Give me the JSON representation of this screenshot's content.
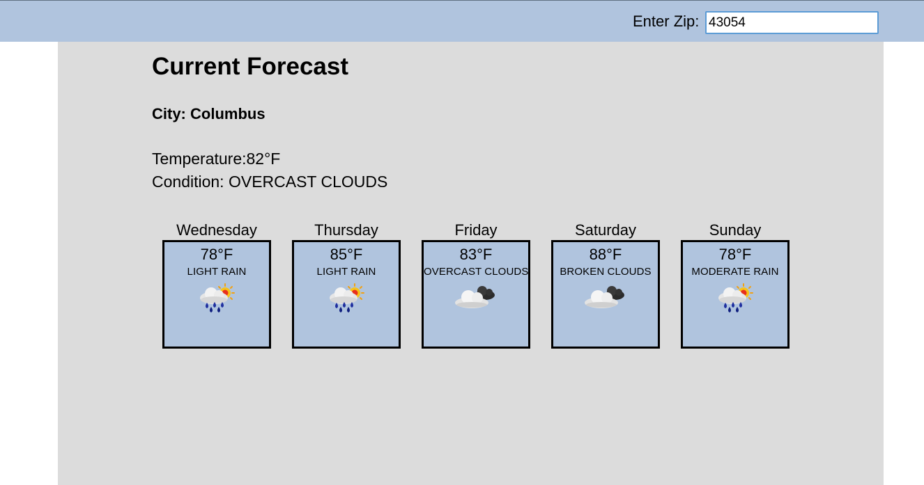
{
  "header": {
    "zip_label": "Enter Zip:",
    "zip_value": "43054"
  },
  "current": {
    "title": "Current Forecast",
    "city": "City: Columbus",
    "temperature": "Temperature:82°F",
    "condition": "Condition: OVERCAST CLOUDS"
  },
  "forecast": [
    {
      "day": "Wednesday",
      "temp": "78°F",
      "condition": "LIGHT RAIN",
      "icon": "rain-sun-icon"
    },
    {
      "day": "Thursday",
      "temp": "85°F",
      "condition": "LIGHT RAIN",
      "icon": "rain-sun-icon"
    },
    {
      "day": "Friday",
      "temp": "83°F",
      "condition": "OVERCAST CLOUDS",
      "icon": "overcast-clouds-icon"
    },
    {
      "day": "Saturday",
      "temp": "88°F",
      "condition": "BROKEN CLOUDS",
      "icon": "broken-clouds-icon"
    },
    {
      "day": "Sunday",
      "temp": "78°F",
      "condition": "MODERATE RAIN",
      "icon": "rain-sun-icon"
    }
  ],
  "colors": {
    "header_bg": "#b0c4de",
    "content_bg": "#dcdcdc",
    "card_bg": "#b0c4de",
    "input_border": "#5b9bd5"
  }
}
